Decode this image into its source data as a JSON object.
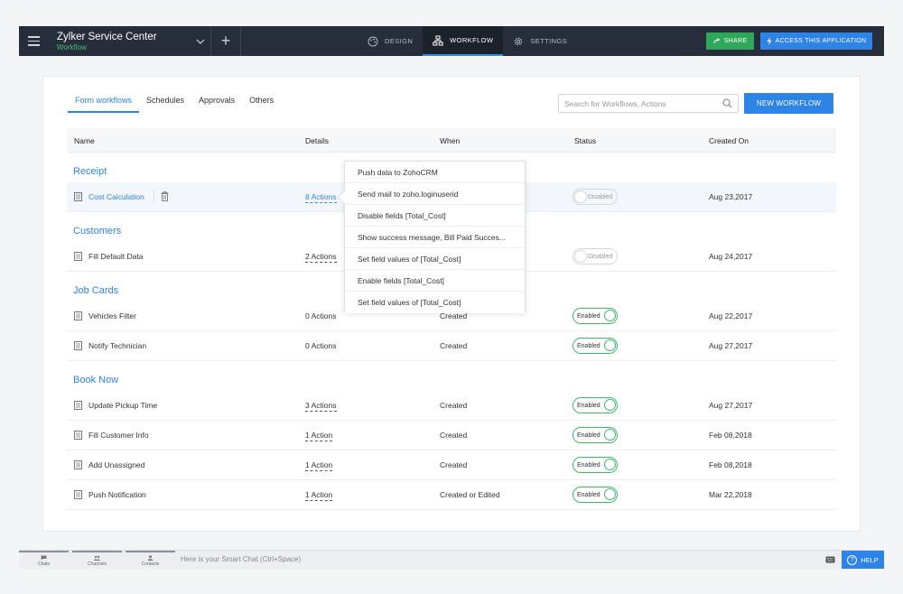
{
  "topbar": {
    "app_title": "Zylker Service Center",
    "app_subtitle": "Workflow",
    "plus_label": "+",
    "tabs": [
      {
        "label": "DESIGN",
        "icon": "palette-icon"
      },
      {
        "label": "WORKFLOW",
        "icon": "workflow-icon"
      },
      {
        "label": "SETTINGS",
        "icon": "gear-icon"
      }
    ],
    "share_label": "SHARE",
    "access_label": "ACCESS THIS APPLICATION"
  },
  "tabs": [
    {
      "label": "Form workflows",
      "active": true
    },
    {
      "label": "Schedules"
    },
    {
      "label": "Approvals"
    },
    {
      "label": "Others"
    }
  ],
  "search": {
    "placeholder": "Search for Workflows, Actions",
    "value": ""
  },
  "new_workflow_label": "NEW WORKFLOW",
  "columns": {
    "name": "Name",
    "details": "Details",
    "when": "When",
    "status": "Status",
    "created_on": "Created On"
  },
  "groups": [
    {
      "title": "Receipt",
      "rows": [
        {
          "name": "Cost Calculation",
          "details": "8 Actions",
          "when": "",
          "status": "Disabled",
          "created": "Aug 23,2017"
        }
      ]
    },
    {
      "title": "Customers",
      "rows": [
        {
          "name": "Fill Default Data",
          "details": "2 Actions",
          "when": "",
          "status": "Disabled",
          "created": "Aug 24,2017"
        }
      ]
    },
    {
      "title": "Job Cards",
      "rows": [
        {
          "name": "Vehicles Filter",
          "details": "0 Actions",
          "when": "Created",
          "status": "Enabled",
          "created": "Aug 22,2017"
        },
        {
          "name": "Notify Technician",
          "details": "0 Actions",
          "when": "Created",
          "status": "Enabled",
          "created": "Aug 27,2017"
        }
      ]
    },
    {
      "title": "Book Now",
      "rows": [
        {
          "name": "Update Pickup Time",
          "details": "3 Actions",
          "when": "Created",
          "status": "Enabled",
          "created": "Aug 27,2017"
        },
        {
          "name": "Fill Customer Info",
          "details": "1 Action",
          "when": "Created",
          "status": "Enabled",
          "created": "Feb 08,2018"
        },
        {
          "name": "Add Unassigned",
          "details": "1 Action",
          "when": "Created",
          "status": "Enabled",
          "created": "Feb 08,2018"
        },
        {
          "name": "Push Notification",
          "details": "1 Action",
          "when": "Created or Edited",
          "status": "Enabled",
          "created": "Mar 22,2018"
        }
      ]
    }
  ],
  "popover": {
    "items": [
      "Push data to ZohoCRM",
      "Send mail to zoho.loginuserid",
      "Disable fields [Total_Cost]",
      "Show success message, Bill Paid Succes...",
      "Set field values of [Total_Cost]",
      "Enable fields [Total_Cost]",
      "Set field values of [Total_Cost]"
    ]
  },
  "bottombar": {
    "items": [
      {
        "label": "Chats",
        "icon": "chat-icon"
      },
      {
        "label": "Channels",
        "icon": "channels-icon"
      },
      {
        "label": "Contacts",
        "icon": "contacts-icon"
      }
    ],
    "chat_placeholder": "Here is your Smart Chat (Ctrl+Space)",
    "help_label": "HELP",
    "help_symbol": "?"
  },
  "colors": {
    "accent": "#2d84e6",
    "topbar": "#272e3b",
    "share_green": "#2fa85a",
    "enabled_green": "#3fb86a"
  }
}
